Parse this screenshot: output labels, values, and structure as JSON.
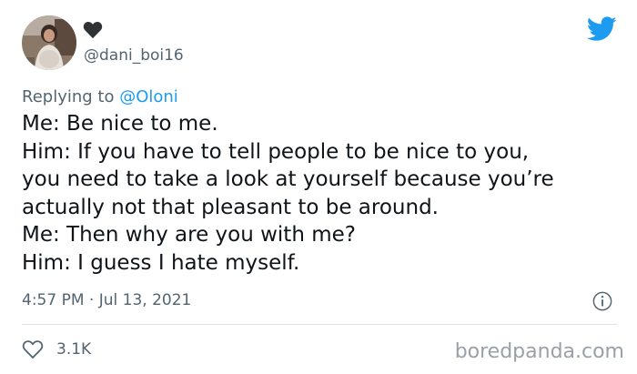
{
  "author": {
    "handle": "@dani_boi16",
    "avatar_icon": "profile-photo",
    "badge_icon": "heart-icon"
  },
  "reply_context": {
    "prefix": "Replying to",
    "mention": "@Oloni"
  },
  "tweet": {
    "lines": [
      "Me: Be nice to me.",
      "Him: If you have to tell people to be nice to you,",
      "you need to take a look at yourself because you’re",
      "actually not that pleasant to be around.",
      "Me: Then why are you with me?",
      "Him: I guess I hate myself."
    ],
    "timestamp": "4:57 PM · Jul 13, 2021"
  },
  "engagement": {
    "like_icon": "heart-outline-icon",
    "like_count": "3.1K"
  },
  "icons": {
    "brand": "twitter-bird-icon",
    "info": "info-icon"
  },
  "watermark": "boredpanda.com",
  "colors": {
    "twitter_blue": "#1d9bf0",
    "secondary_text": "#536471",
    "primary_text": "#0f1419",
    "divider": "#dfe4e8",
    "watermark": "#9aa0a6"
  }
}
